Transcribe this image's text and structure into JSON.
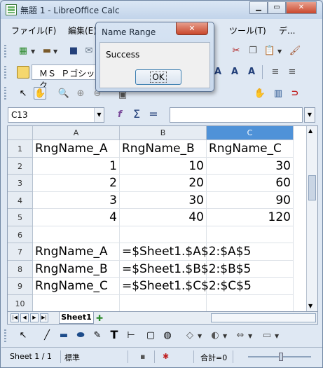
{
  "window": {
    "title": "無題 1 - LibreOffice Calc"
  },
  "menu": [
    "ファイル(F)",
    "編集(E)",
    "ツール(T)",
    "デ..."
  ],
  "toolbar": {
    "font_name": "ＭＳ Ｐゴシック"
  },
  "formula_bar": {
    "cell_ref": "C13",
    "formula": ""
  },
  "sheet": {
    "columns": [
      "A",
      "B",
      "C"
    ],
    "selected_column": "C",
    "rows": [
      {
        "num": "1",
        "a": "RngName_A",
        "b": "RngName_B",
        "c": "RngName_C"
      },
      {
        "num": "2",
        "a": "1",
        "b": "10",
        "c": "30"
      },
      {
        "num": "3",
        "a": "2",
        "b": "20",
        "c": "60"
      },
      {
        "num": "4",
        "a": "3",
        "b": "30",
        "c": "90"
      },
      {
        "num": "5",
        "a": "4",
        "b": "40",
        "c": "120"
      },
      {
        "num": "6",
        "a": "",
        "b": "",
        "c": ""
      },
      {
        "num": "7",
        "a": "RngName_A",
        "b": "=$Sheet1.$A$2:$A$5",
        "c": ""
      },
      {
        "num": "8",
        "a": "RngName_B",
        "b": "=$Sheet1.$B$2:$B$5",
        "c": ""
      },
      {
        "num": "9",
        "a": "RngName_C",
        "b": "=$Sheet1.$C$2:$C$5",
        "c": ""
      },
      {
        "num": "10",
        "a": "",
        "b": "",
        "c": ""
      }
    ]
  },
  "tabs": {
    "sheet_tab": "Sheet1"
  },
  "statusbar": {
    "sheet_pos": "Sheet 1 / 1",
    "style": "標準",
    "sum": "合計=0"
  },
  "dialog": {
    "title": "Name Range",
    "message": "Success",
    "ok_label": "OK"
  }
}
